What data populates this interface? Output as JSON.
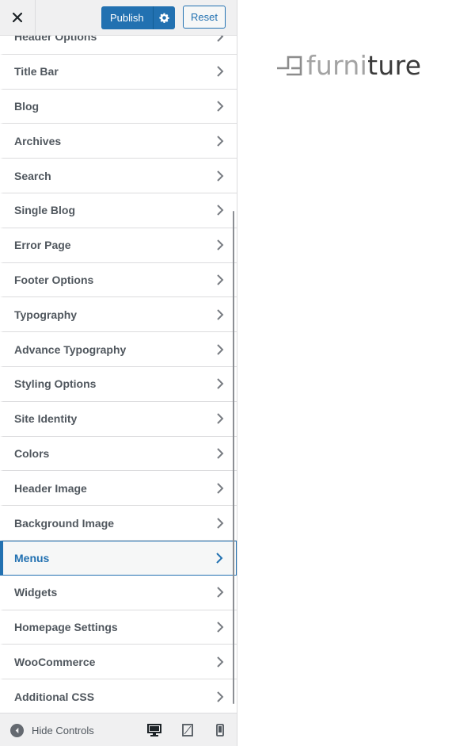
{
  "header": {
    "close_icon": "close-icon",
    "publish_label": "Publish",
    "gear_icon": "gear-icon",
    "reset_label": "Reset"
  },
  "panels": [
    {
      "label": "Header Options",
      "active": false
    },
    {
      "label": "Title Bar",
      "active": false
    },
    {
      "label": "Blog",
      "active": false
    },
    {
      "label": "Archives",
      "active": false
    },
    {
      "label": "Search",
      "active": false
    },
    {
      "label": "Single Blog",
      "active": false
    },
    {
      "label": "Error Page",
      "active": false
    },
    {
      "label": "Footer Options",
      "active": false
    },
    {
      "label": "Typography",
      "active": false
    },
    {
      "label": "Advance Typography",
      "active": false
    },
    {
      "label": "Styling Options",
      "active": false
    },
    {
      "label": "Site Identity",
      "active": false
    },
    {
      "label": "Colors",
      "active": false
    },
    {
      "label": "Header Image",
      "active": false
    },
    {
      "label": "Background Image",
      "active": false
    },
    {
      "label": "Menus",
      "active": true
    },
    {
      "label": "Widgets",
      "active": false
    },
    {
      "label": "Homepage Settings",
      "active": false
    },
    {
      "label": "WooCommerce",
      "active": false
    },
    {
      "label": "Additional CSS",
      "active": false
    }
  ],
  "footer": {
    "hide_controls_label": "Hide Controls",
    "devices": [
      "desktop",
      "tablet",
      "mobile"
    ]
  },
  "preview": {
    "logo_light": "furni",
    "logo_dark": "ture"
  },
  "colors": {
    "accent": "#2271b1",
    "panel_text": "#50575e",
    "sidebar_bg": "#f0f0f1"
  }
}
